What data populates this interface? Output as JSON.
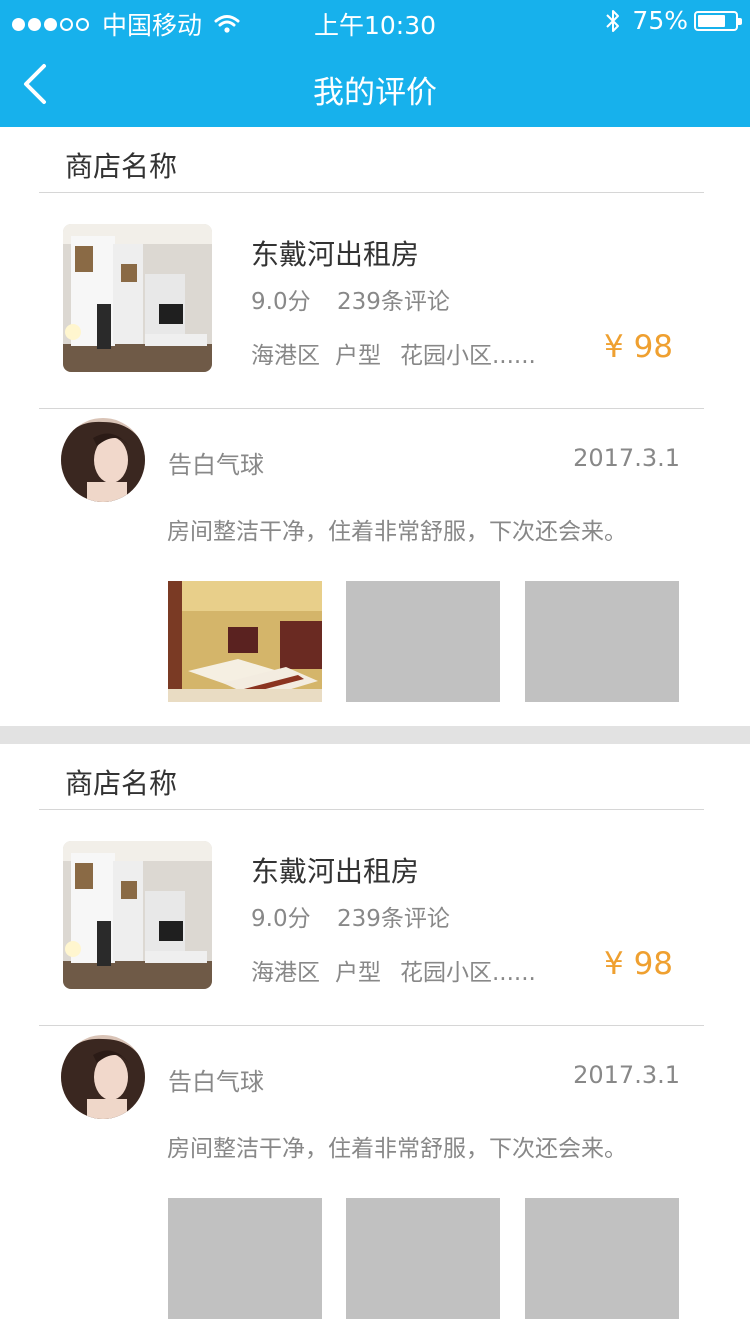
{
  "status_bar": {
    "carrier": "中国移动",
    "time": "上午10:30",
    "battery": "75%",
    "battery_level": 0.75,
    "icons": [
      "signal-dots",
      "wifi-icon",
      "bluetooth-icon",
      "battery-icon"
    ]
  },
  "nav": {
    "title": "我的评价",
    "back_icon": "chevron-left-icon"
  },
  "colors": {
    "header": "#17b1ec",
    "price": "#efa030",
    "placeholder": "#c1c1c1"
  },
  "reviews": [
    {
      "shop_name": "商店名称",
      "listing": {
        "title": "东戴河出租房",
        "score": "9.0分",
        "review_count": "239条评论",
        "tags": [
          "海港区",
          "户型",
          "花园小区......"
        ],
        "price": "¥ 98"
      },
      "reviewer": {
        "name": "告白气球",
        "date": "2017.3.1"
      },
      "comment": "房间整洁干净，住着非常舒服，下次还会来。",
      "photos": [
        "hotel-room-photo",
        "placeholder",
        "placeholder"
      ]
    },
    {
      "shop_name": "商店名称",
      "listing": {
        "title": "东戴河出租房",
        "score": "9.0分",
        "review_count": "239条评论",
        "tags": [
          "海港区",
          "户型",
          "花园小区......"
        ],
        "price": "¥ 98"
      },
      "reviewer": {
        "name": "告白气球",
        "date": "2017.3.1"
      },
      "comment": "房间整洁干净，住着非常舒服，下次还会来。",
      "photos": [
        "placeholder",
        "placeholder",
        "placeholder"
      ]
    }
  ]
}
